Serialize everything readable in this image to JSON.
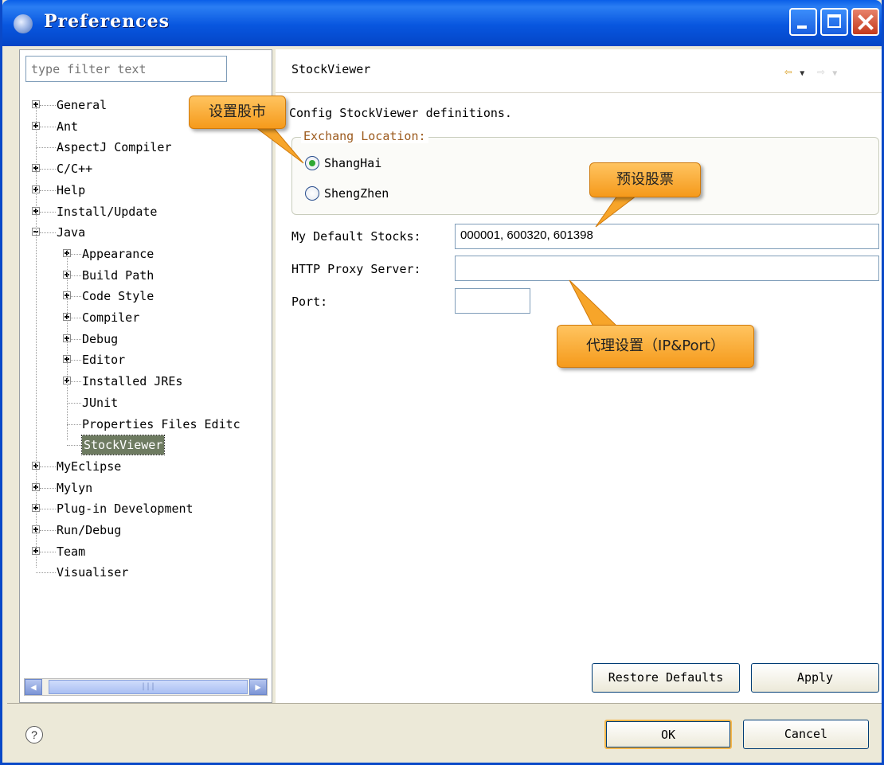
{
  "window": {
    "title": "Preferences"
  },
  "filter": {
    "placeholder": "type filter text"
  },
  "tree": [
    {
      "label": "General",
      "expander": "plus"
    },
    {
      "label": "Ant",
      "expander": "plus"
    },
    {
      "label": "AspectJ Compiler",
      "expander": "none"
    },
    {
      "label": "C/C++",
      "expander": "plus"
    },
    {
      "label": "Help",
      "expander": "plus"
    },
    {
      "label": "Install/Update",
      "expander": "plus"
    },
    {
      "label": "Java",
      "expander": "minus"
    },
    {
      "label": "Appearance",
      "expander": "plus"
    },
    {
      "label": "Build Path",
      "expander": "plus"
    },
    {
      "label": "Code Style",
      "expander": "plus"
    },
    {
      "label": "Compiler",
      "expander": "plus"
    },
    {
      "label": "Debug",
      "expander": "plus"
    },
    {
      "label": "Editor",
      "expander": "plus"
    },
    {
      "label": "Installed JREs",
      "expander": "plus"
    },
    {
      "label": "JUnit",
      "expander": "none"
    },
    {
      "label": "Properties Files Editc",
      "expander": "none"
    },
    {
      "label": "StockViewer",
      "expander": "none",
      "selected": true
    },
    {
      "label": "MyEclipse",
      "expander": "plus"
    },
    {
      "label": "Mylyn",
      "expander": "plus"
    },
    {
      "label": "Plug-in Development",
      "expander": "plus"
    },
    {
      "label": "Run/Debug",
      "expander": "plus"
    },
    {
      "label": "Team",
      "expander": "plus"
    },
    {
      "label": "Visualiser",
      "expander": "none"
    }
  ],
  "page": {
    "title": "StockViewer",
    "description": "Config StockViewer definitions.",
    "group_label": "Exchang Location:",
    "radio_shanghai": "ShangHai",
    "radio_shenzhen": "ShengZhen",
    "selected_exchange": "ShangHai",
    "default_stocks_label": "My Default Stocks:",
    "default_stocks_value": "000001, 600320, 601398",
    "proxy_label": "HTTP Proxy Server:",
    "proxy_value": "",
    "port_label": "Port:",
    "port_value": "",
    "restore_defaults": "Restore Defaults",
    "apply": "Apply"
  },
  "footer": {
    "ok": "OK",
    "cancel": "Cancel",
    "help_glyph": "?"
  },
  "callouts": {
    "exchange": "设置股市",
    "stocks": "预设股票",
    "proxy": "代理设置（IP&Port）"
  },
  "colors": {
    "titlebar": "#0a5fe8",
    "callout": "#f59a1b",
    "selection": "#6e7b61",
    "group_label": "#9c5a1d"
  },
  "icons": {
    "back": "back-arrow-icon",
    "forward": "forward-arrow-icon",
    "help": "help-icon"
  }
}
